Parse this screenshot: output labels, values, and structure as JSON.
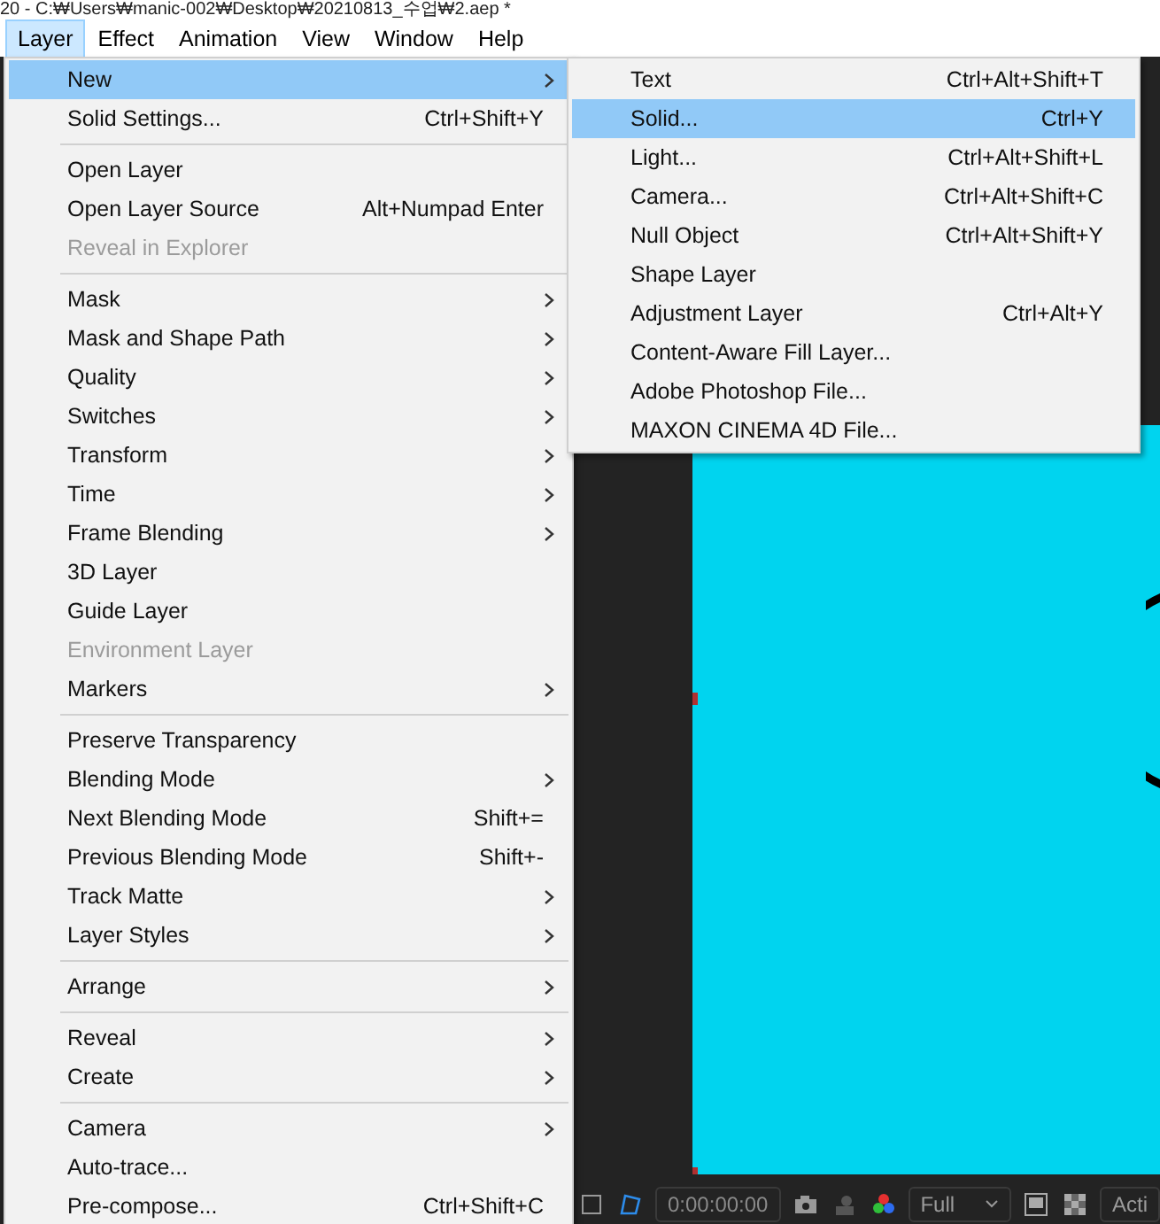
{
  "title_bar": {
    "text": "20 - C:₩Users₩manic-002₩Desktop₩20210813_수업₩2.aep *"
  },
  "menu_bar": [
    {
      "label": "Layer",
      "selected": true
    },
    {
      "label": "Effect",
      "selected": false
    },
    {
      "label": "Animation",
      "selected": false
    },
    {
      "label": "View",
      "selected": false
    },
    {
      "label": "Window",
      "selected": false
    },
    {
      "label": "Help",
      "selected": false
    }
  ],
  "layer_menu": {
    "items": [
      {
        "kind": "item",
        "label": "New",
        "submenu": true,
        "disabled": false,
        "selected": true
      },
      {
        "kind": "item",
        "label": "Solid Settings...",
        "shortcut": "Ctrl+Shift+Y",
        "submenu": false,
        "disabled": false,
        "selected": false
      },
      {
        "kind": "separator"
      },
      {
        "kind": "item",
        "label": "Open Layer",
        "submenu": false,
        "disabled": false,
        "selected": false
      },
      {
        "kind": "item",
        "label": "Open Layer Source",
        "shortcut": "Alt+Numpad Enter",
        "submenu": false,
        "disabled": false,
        "selected": false
      },
      {
        "kind": "item",
        "label": "Reveal in Explorer",
        "submenu": false,
        "disabled": true,
        "selected": false
      },
      {
        "kind": "separator"
      },
      {
        "kind": "item",
        "label": "Mask",
        "submenu": true,
        "disabled": false,
        "selected": false
      },
      {
        "kind": "item",
        "label": "Mask and Shape Path",
        "submenu": true,
        "disabled": false,
        "selected": false
      },
      {
        "kind": "item",
        "label": "Quality",
        "submenu": true,
        "disabled": false,
        "selected": false
      },
      {
        "kind": "item",
        "label": "Switches",
        "submenu": true,
        "disabled": false,
        "selected": false
      },
      {
        "kind": "item",
        "label": "Transform",
        "submenu": true,
        "disabled": false,
        "selected": false
      },
      {
        "kind": "item",
        "label": "Time",
        "submenu": true,
        "disabled": false,
        "selected": false
      },
      {
        "kind": "item",
        "label": "Frame Blending",
        "submenu": true,
        "disabled": false,
        "selected": false
      },
      {
        "kind": "item",
        "label": "3D Layer",
        "submenu": false,
        "disabled": false,
        "selected": false
      },
      {
        "kind": "item",
        "label": "Guide Layer",
        "submenu": false,
        "disabled": false,
        "selected": false
      },
      {
        "kind": "item",
        "label": "Environment Layer",
        "submenu": false,
        "disabled": true,
        "selected": false
      },
      {
        "kind": "item",
        "label": "Markers",
        "submenu": true,
        "disabled": false,
        "selected": false
      },
      {
        "kind": "separator"
      },
      {
        "kind": "item",
        "label": "Preserve Transparency",
        "submenu": false,
        "disabled": false,
        "selected": false
      },
      {
        "kind": "item",
        "label": "Blending Mode",
        "submenu": true,
        "disabled": false,
        "selected": false
      },
      {
        "kind": "item",
        "label": "Next Blending Mode",
        "shortcut": "Shift+=",
        "submenu": false,
        "disabled": false,
        "selected": false
      },
      {
        "kind": "item",
        "label": "Previous Blending Mode",
        "shortcut": "Shift+-",
        "submenu": false,
        "disabled": false,
        "selected": false
      },
      {
        "kind": "item",
        "label": "Track Matte",
        "submenu": true,
        "disabled": false,
        "selected": false
      },
      {
        "kind": "item",
        "label": "Layer Styles",
        "submenu": true,
        "disabled": false,
        "selected": false
      },
      {
        "kind": "separator"
      },
      {
        "kind": "item",
        "label": "Arrange",
        "submenu": true,
        "disabled": false,
        "selected": false
      },
      {
        "kind": "separator"
      },
      {
        "kind": "item",
        "label": "Reveal",
        "submenu": true,
        "disabled": false,
        "selected": false
      },
      {
        "kind": "item",
        "label": "Create",
        "submenu": true,
        "disabled": false,
        "selected": false
      },
      {
        "kind": "separator"
      },
      {
        "kind": "item",
        "label": "Camera",
        "submenu": true,
        "disabled": false,
        "selected": false
      },
      {
        "kind": "item",
        "label": "Auto-trace...",
        "submenu": false,
        "disabled": false,
        "selected": false
      },
      {
        "kind": "item",
        "label": "Pre-compose...",
        "shortcut": "Ctrl+Shift+C",
        "submenu": false,
        "disabled": false,
        "selected": false
      }
    ]
  },
  "new_submenu": {
    "items": [
      {
        "kind": "item",
        "label": "Text",
        "shortcut": "Ctrl+Alt+Shift+T",
        "submenu": false,
        "disabled": false,
        "selected": false
      },
      {
        "kind": "item",
        "label": "Solid...",
        "shortcut": "Ctrl+Y",
        "submenu": false,
        "disabled": false,
        "selected": true
      },
      {
        "kind": "item",
        "label": "Light...",
        "shortcut": "Ctrl+Alt+Shift+L",
        "submenu": false,
        "disabled": false,
        "selected": false
      },
      {
        "kind": "item",
        "label": "Camera...",
        "shortcut": "Ctrl+Alt+Shift+C",
        "submenu": false,
        "disabled": false,
        "selected": false
      },
      {
        "kind": "item",
        "label": "Null Object",
        "shortcut": "Ctrl+Alt+Shift+Y",
        "submenu": false,
        "disabled": false,
        "selected": false
      },
      {
        "kind": "item",
        "label": "Shape Layer",
        "submenu": false,
        "disabled": false,
        "selected": false
      },
      {
        "kind": "item",
        "label": "Adjustment Layer",
        "shortcut": "Ctrl+Alt+Y",
        "submenu": false,
        "disabled": false,
        "selected": false
      },
      {
        "kind": "item",
        "label": "Content-Aware Fill Layer...",
        "submenu": false,
        "disabled": false,
        "selected": false
      },
      {
        "kind": "item",
        "label": "Adobe Photoshop File...",
        "submenu": false,
        "disabled": false,
        "selected": false
      },
      {
        "kind": "item",
        "label": "MAXON CINEMA 4D File...",
        "submenu": false,
        "disabled": false,
        "selected": false
      }
    ]
  },
  "viewer_toolbar": {
    "timecode": "0:00:00:00",
    "resolution": "Full",
    "view": "Acti"
  }
}
